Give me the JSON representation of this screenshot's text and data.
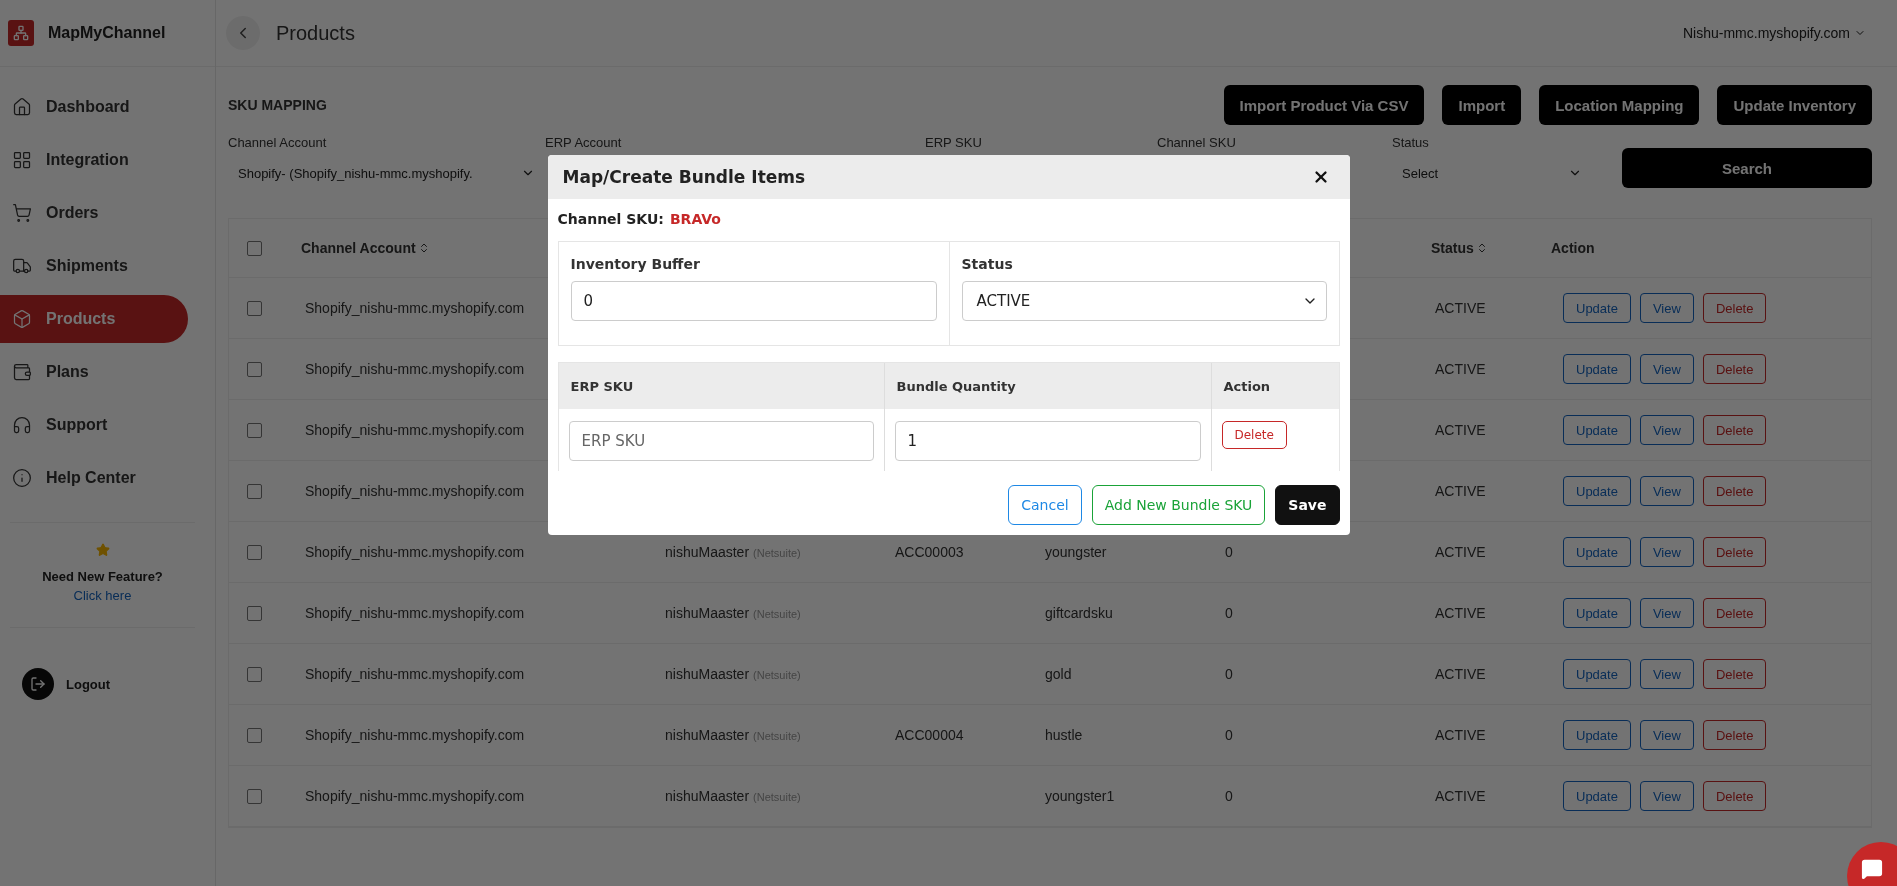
{
  "brand": {
    "name": "MapMyChannel"
  },
  "sidebar": {
    "items": [
      {
        "label": "Dashboard",
        "selected": false
      },
      {
        "label": "Integration",
        "selected": false
      },
      {
        "label": "Orders",
        "selected": false
      },
      {
        "label": "Shipments",
        "selected": false
      },
      {
        "label": "Products",
        "selected": true
      },
      {
        "label": "Plans",
        "selected": false
      },
      {
        "label": "Support",
        "selected": false
      },
      {
        "label": "Help Center",
        "selected": false
      }
    ],
    "feature_card": {
      "title": "Need New Feature?",
      "link": "Click here"
    },
    "logout": "Logout"
  },
  "header": {
    "title": "Products",
    "account": "Nishu-mmc.myshopify.com"
  },
  "section_title": "SKU MAPPING",
  "actions": [
    "Import Product Via CSV",
    "Import",
    "Location Mapping",
    "Update Inventory"
  ],
  "filters": {
    "channel_account": {
      "label": "Channel Account",
      "value": "Shopify- (Shopify_nishu-mmc.myshopify."
    },
    "labels": [
      "ERP Account",
      "ERP SKU",
      "Channel SKU"
    ],
    "status": {
      "label": "Status",
      "value": "Select"
    },
    "search": "Search"
  },
  "table": {
    "header_checked": false,
    "columns": [
      {
        "label": "Channel Account",
        "sortable": true
      },
      {
        "label": "Status",
        "sortable": true
      },
      {
        "label": "Action",
        "sortable": false
      }
    ],
    "rows": [
      {
        "checked": false,
        "channel_account": "Shopify_nishu-mmc.myshopify.com",
        "status": "ACTIVE",
        "actions": [
          "Update",
          "View",
          "Delete"
        ]
      },
      {
        "checked": false,
        "channel_account": "Shopify_nishu-mmc.myshopify.com",
        "status": "ACTIVE",
        "actions": [
          "Update",
          "View",
          "Delete"
        ]
      },
      {
        "checked": false,
        "channel_account": "Shopify_nishu-mmc.myshopify.com",
        "status": "ACTIVE",
        "actions": [
          "Update",
          "View",
          "Delete"
        ]
      },
      {
        "checked": false,
        "channel_account": "Shopify_nishu-mmc.myshopify.com",
        "status": "ACTIVE",
        "actions": [
          "Update",
          "View",
          "Delete"
        ]
      },
      {
        "checked": false,
        "channel_account": "Shopify_nishu-mmc.myshopify.com",
        "erp_account": "nishuMaaster",
        "erp_platform": "(Netsuite)",
        "erp_sku": "ACC00003",
        "channel_sku": "youngster",
        "inventory": "0",
        "status": "ACTIVE",
        "actions": [
          "Update",
          "View",
          "Delete"
        ]
      },
      {
        "checked": false,
        "channel_account": "Shopify_nishu-mmc.myshopify.com",
        "erp_account": "nishuMaaster",
        "erp_platform": "(Netsuite)",
        "channel_sku": "giftcardsku",
        "inventory": "0",
        "status": "ACTIVE",
        "actions": [
          "Update",
          "View",
          "Delete"
        ]
      },
      {
        "checked": false,
        "channel_account": "Shopify_nishu-mmc.myshopify.com",
        "erp_account": "nishuMaaster",
        "erp_platform": "(Netsuite)",
        "channel_sku": "gold",
        "inventory": "0",
        "status": "ACTIVE",
        "actions": [
          "Update",
          "View",
          "Delete"
        ]
      },
      {
        "checked": false,
        "channel_account": "Shopify_nishu-mmc.myshopify.com",
        "erp_account": "nishuMaaster",
        "erp_platform": "(Netsuite)",
        "erp_sku": "ACC00004",
        "channel_sku": "hustle",
        "inventory": "0",
        "status": "ACTIVE",
        "actions": [
          "Update",
          "View",
          "Delete"
        ]
      },
      {
        "checked": false,
        "channel_account": "Shopify_nishu-mmc.myshopify.com",
        "erp_account": "nishuMaaster",
        "erp_platform": "(Netsuite)",
        "channel_sku": "youngster1",
        "inventory": "0",
        "status": "ACTIVE",
        "actions": [
          "Update",
          "View",
          "Delete"
        ]
      }
    ]
  },
  "modal": {
    "title": "Map/Create Bundle Items",
    "channel_sku": {
      "label": "Channel SKU:",
      "value": "BRAVo"
    },
    "inventory_buffer": {
      "label": "Inventory Buffer",
      "value": "0"
    },
    "status": {
      "label": "Status",
      "value": "ACTIVE"
    },
    "bundle_columns": [
      "ERP SKU",
      "Bundle Quantity",
      "Action"
    ],
    "bundle_rows": [
      {
        "erp_sku_placeholder": "ERP SKU",
        "quantity": "1",
        "action": "Delete"
      }
    ],
    "buttons": [
      {
        "label": "Cancel",
        "kind": "outline-blue"
      },
      {
        "label": "Add New Bundle SKU",
        "kind": "outline-green"
      },
      {
        "label": "Save",
        "kind": "dark"
      }
    ]
  }
}
